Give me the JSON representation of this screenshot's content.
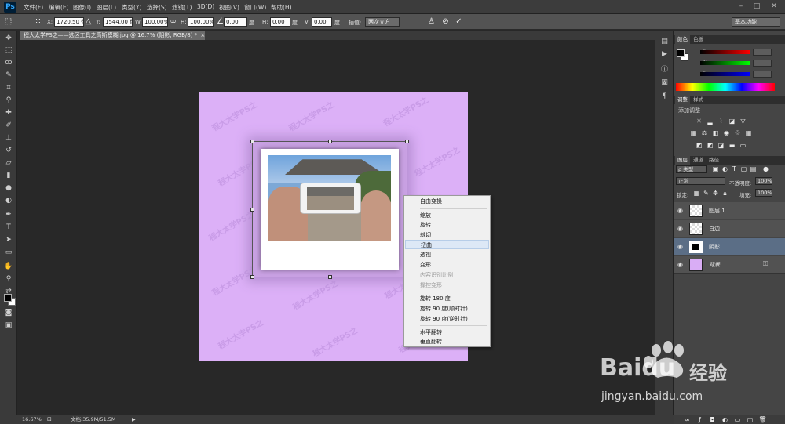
{
  "app": {
    "logo": "Ps"
  },
  "menubar": {
    "items": [
      "文件(F)",
      "编辑(E)",
      "图像(I)",
      "图层(L)",
      "类型(Y)",
      "选择(S)",
      "滤镜(T)",
      "3D(D)",
      "视图(V)",
      "窗口(W)",
      "帮助(H)"
    ],
    "window_controls": [
      "–",
      "□",
      "✕"
    ]
  },
  "options": {
    "x_label": "X:",
    "x_value": "1720.50 像",
    "y_label": "Y:",
    "y_value": "1544.00 像",
    "w_label": "W:",
    "w_value": "100.00%",
    "h_label": "H:",
    "h_value": "100.00%",
    "angle_value": "0.00",
    "angle_unit": "度",
    "hskew_label": "H:",
    "hskew_value": "0.00",
    "hskew_unit": "度",
    "vskew_label": "V:",
    "vskew_value": "0.00",
    "vskew_unit": "度",
    "interp_label": "插值:",
    "interp_value": "两次立方",
    "workspace": "基本功能",
    "cancel_icon": "cancel-icon",
    "commit_icon": "commit-icon"
  },
  "document": {
    "tab_title": "程大太学PS之——选区工具之高斯模糊.jpg @ 16.7% (阴影, RGB/8) *",
    "tab_close": "×",
    "watermark": "程大太学PS之"
  },
  "context_menu": {
    "items": [
      {
        "label": "自由变换",
        "enabled": true
      },
      {
        "label": "缩放",
        "enabled": true
      },
      {
        "label": "旋转",
        "enabled": true
      },
      {
        "label": "斜切",
        "enabled": true
      },
      {
        "label": "扭曲",
        "enabled": true,
        "highlighted": true
      },
      {
        "label": "透视",
        "enabled": true
      },
      {
        "label": "变形",
        "enabled": true
      },
      {
        "label": "内容识别比例",
        "enabled": false
      },
      {
        "label": "操控变形",
        "enabled": false
      },
      {
        "label": "旋转 180 度",
        "enabled": true
      },
      {
        "label": "旋转 90 度(顺时针)",
        "enabled": true
      },
      {
        "label": "旋转 90 度(逆时针)",
        "enabled": true
      },
      {
        "label": "水平翻转",
        "enabled": true
      },
      {
        "label": "垂直翻转",
        "enabled": true
      }
    ]
  },
  "color_panel": {
    "tabs": [
      "颜色",
      "色板"
    ],
    "r_label": "R",
    "g_label": "G",
    "b_label": "B"
  },
  "adjust_panel": {
    "tabs": [
      "调整",
      "样式"
    ],
    "title": "添加调整"
  },
  "layers_panel": {
    "tabs": [
      "图层",
      "通道",
      "路径"
    ],
    "filter": "ρ 类型",
    "blend_mode": "正常",
    "opacity_label": "不透明度:",
    "opacity_value": "100%",
    "lock_label": "锁定:",
    "fill_label": "填充:",
    "fill_value": "100%",
    "layers": [
      {
        "name": "图层 1",
        "selected": false
      },
      {
        "name": "白边",
        "selected": false
      },
      {
        "name": "阴影",
        "selected": true
      },
      {
        "name": "背景",
        "selected": false
      }
    ]
  },
  "status": {
    "zoom": "16.67%",
    "doc": "文档:35.9M/51.5M"
  },
  "watermark_logo": {
    "brand": "Baidu",
    "cn": "经验",
    "url": "jingyan.baidu.com"
  },
  "colors": {
    "canvas": "#dcb0f7",
    "highlight": "#dde8f6",
    "selected_layer": "#5b6e86"
  }
}
